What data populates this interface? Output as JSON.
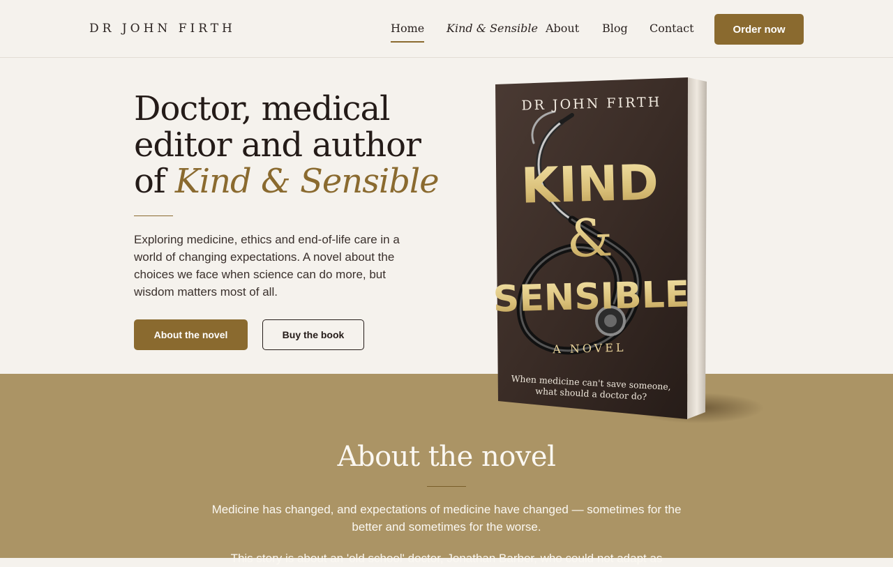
{
  "header": {
    "brand": "DR JOHN FIRTH",
    "nav": [
      "Home",
      "Kind & Sensible",
      "About",
      "Blog",
      "Contact"
    ],
    "active_nav": "Home",
    "order_button": "Order now"
  },
  "hero": {
    "title_line1": "Doctor, medical",
    "title_line2": "editor and author",
    "title_prefix": "of ",
    "title_accent": "Kind & Sensible",
    "description": "Exploring medicine, ethics and end-of-life care in a world of changing expectations. A novel about the choices we face when science can do more, but wisdom matters most of all.",
    "primary_button": "About the novel",
    "secondary_button": "Buy the book"
  },
  "book_cover": {
    "author": "DR JOHN FIRTH",
    "title_word1": "KIND",
    "ampersand": "&",
    "title_word2": "SENSIBLE",
    "subtitle": "A NOVEL",
    "tagline_line1": "When medicine can't save someone,",
    "tagline_line2": "what should a doctor do?"
  },
  "about": {
    "heading": "About the novel",
    "paragraph1": "Medicine has changed, and expectations of medicine have changed — sometimes for the better and sometimes for the worse.",
    "paragraph2": "This story is about an 'old school' doctor, Jonathan Barber, who could not adapt as"
  },
  "colors": {
    "accent": "#8a6a2f",
    "background": "#f5f2ed",
    "band": "#ab9465",
    "text": "#241b18"
  }
}
